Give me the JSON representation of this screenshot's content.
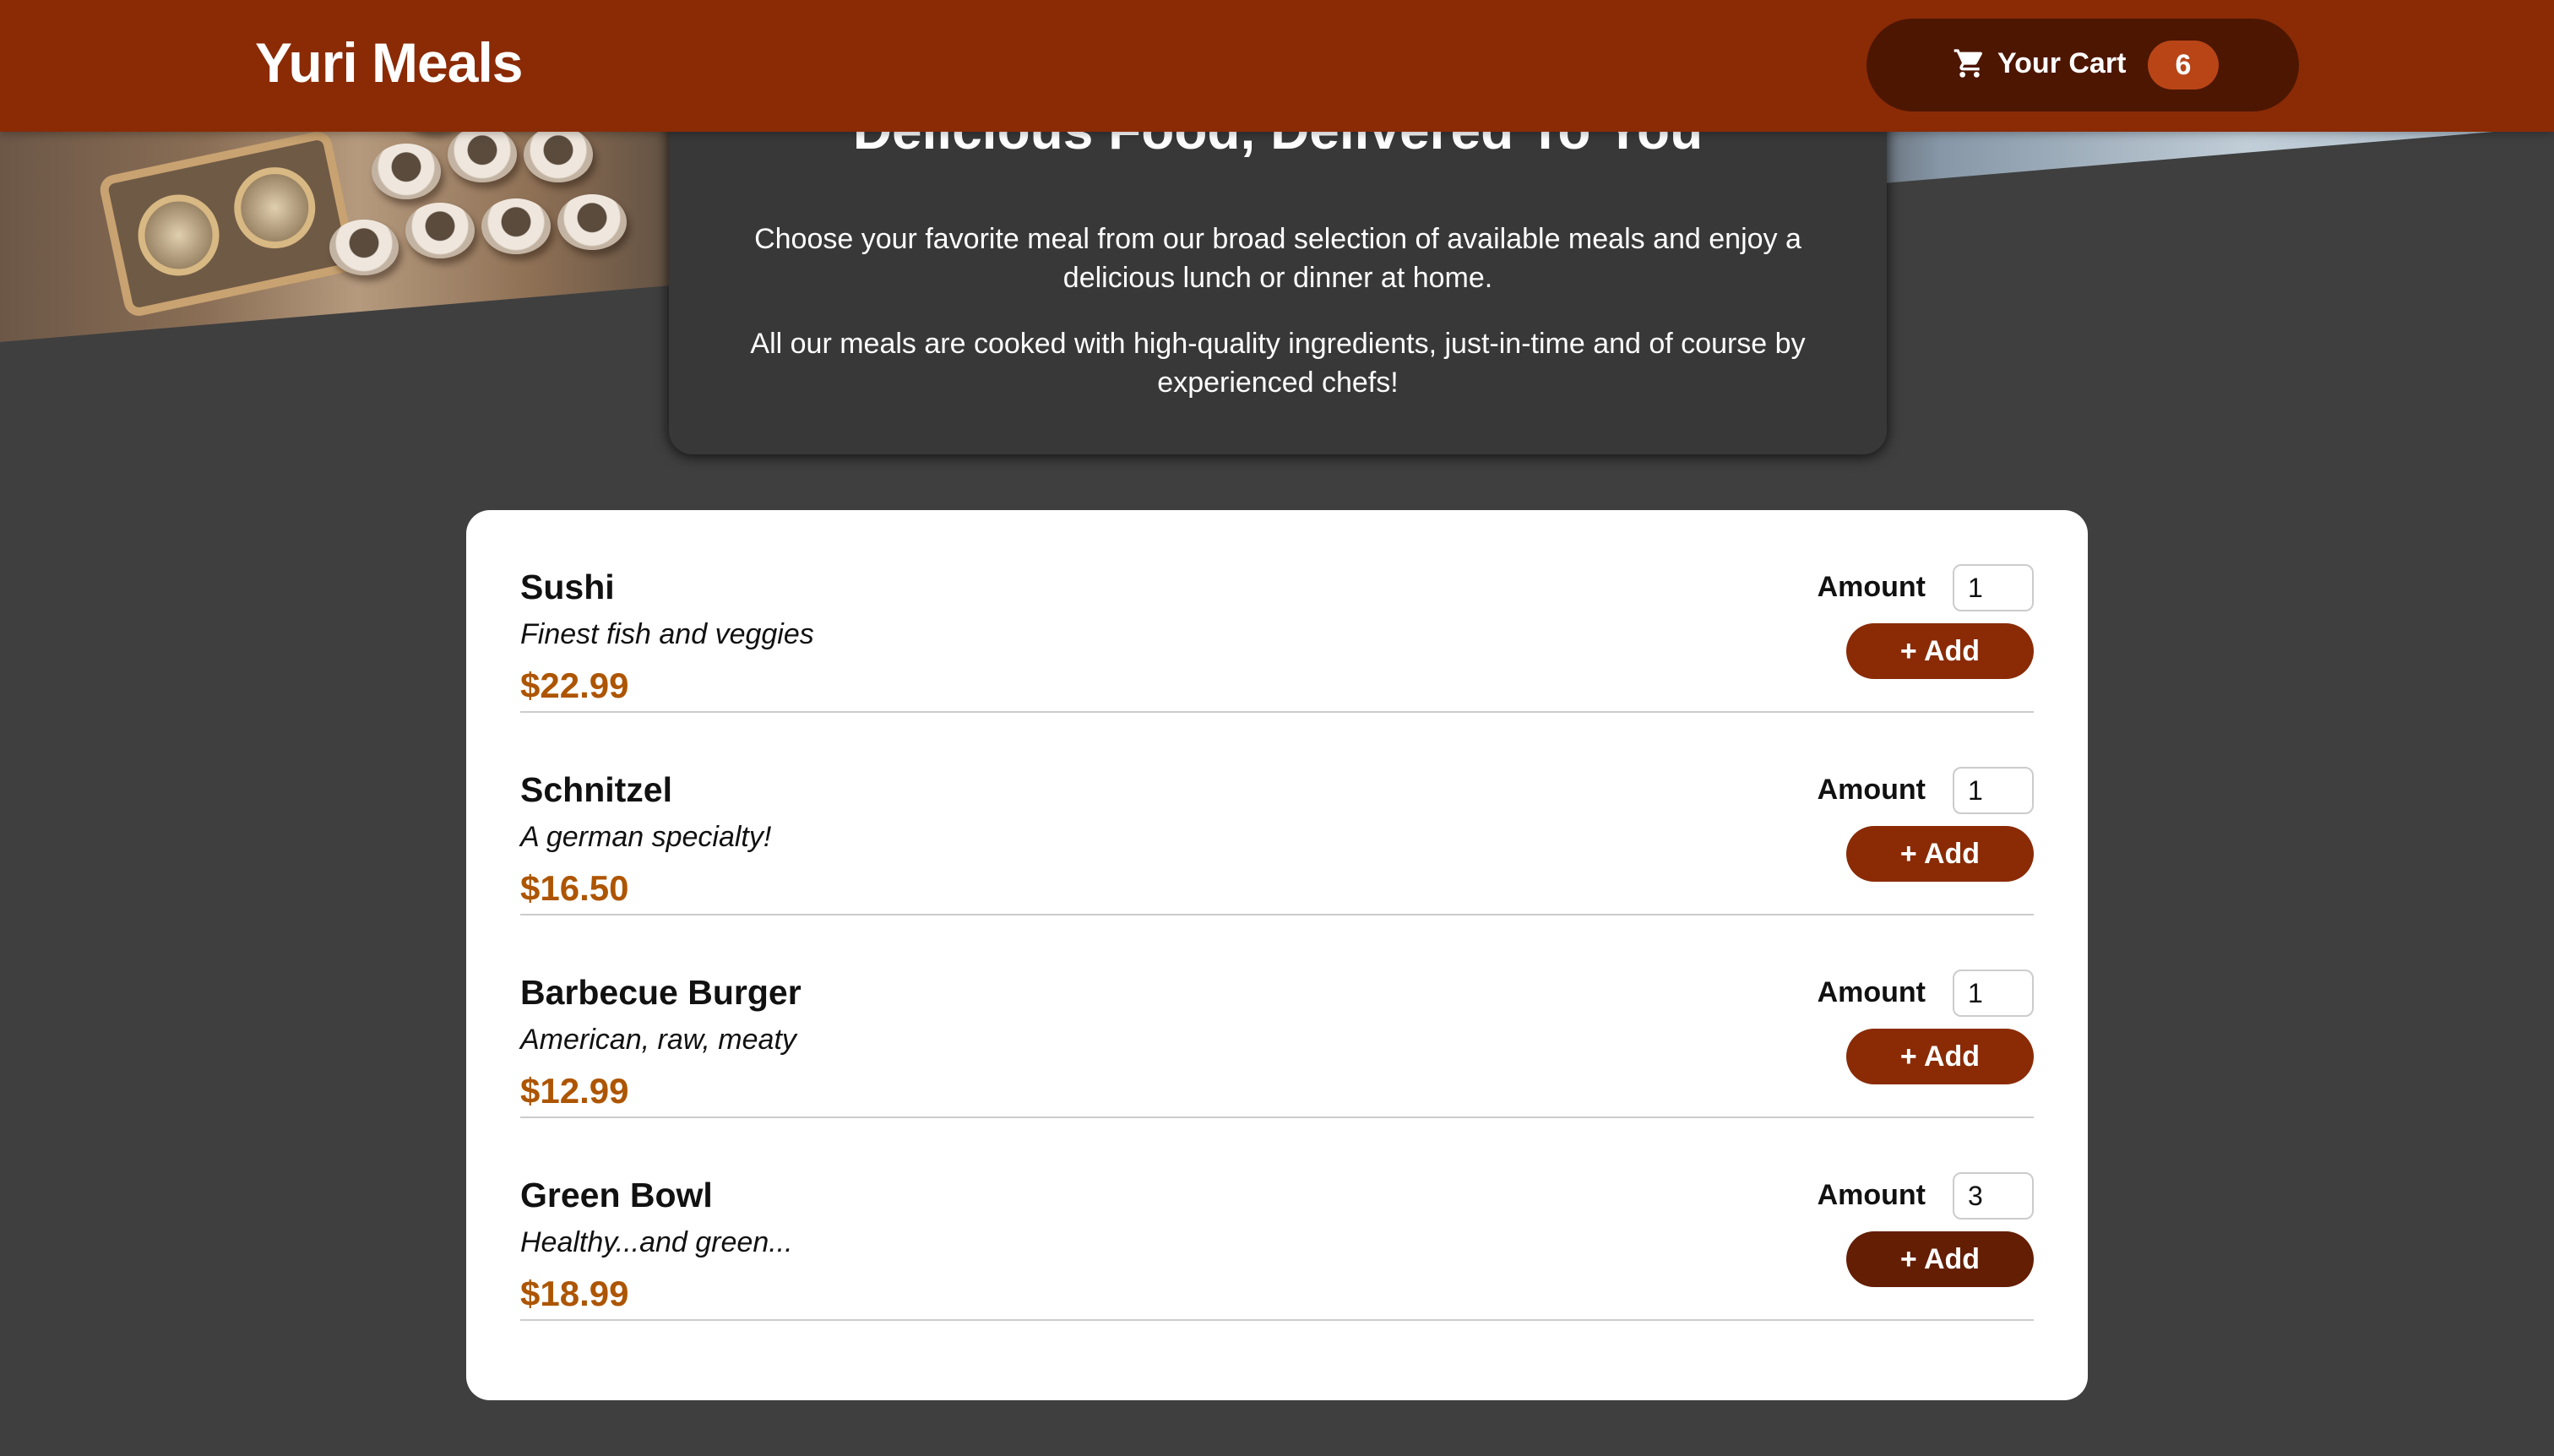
{
  "header": {
    "app_title": "Yuri Meals",
    "cart_label": "Your Cart",
    "cart_count": "6",
    "cart_icon": "shopping-cart-icon"
  },
  "summary": {
    "title": "Delicious Food, Delivered To You",
    "paragraph_1": "Choose your favorite meal from our broad selection of available meals and enjoy a delicious lunch or dinner at home.",
    "paragraph_2": "All our meals are cooked with high-quality ingredients, just-in-time and of course by experienced chefs!"
  },
  "meals": [
    {
      "name": "Sushi",
      "description": "Finest fish and veggies",
      "price": "$22.99",
      "amount_label": "Amount",
      "amount": "1",
      "add_label": "+ Add"
    },
    {
      "name": "Schnitzel",
      "description": "A german specialty!",
      "price": "$16.50",
      "amount_label": "Amount",
      "amount": "1",
      "add_label": "+ Add"
    },
    {
      "name": "Barbecue Burger",
      "description": "American, raw, meaty",
      "price": "$12.99",
      "amount_label": "Amount",
      "amount": "1",
      "add_label": "+ Add"
    },
    {
      "name": "Green Bowl",
      "description": "Healthy...and green...",
      "price": "$18.99",
      "amount_label": "Amount",
      "amount": "3",
      "add_label": "+ Add"
    }
  ],
  "colors": {
    "header_bg": "#8a2b06",
    "cart_button_bg": "#4d1601",
    "cart_badge_bg": "#b94517",
    "price": "#ad5502",
    "page_bg": "#3f3f3f"
  }
}
